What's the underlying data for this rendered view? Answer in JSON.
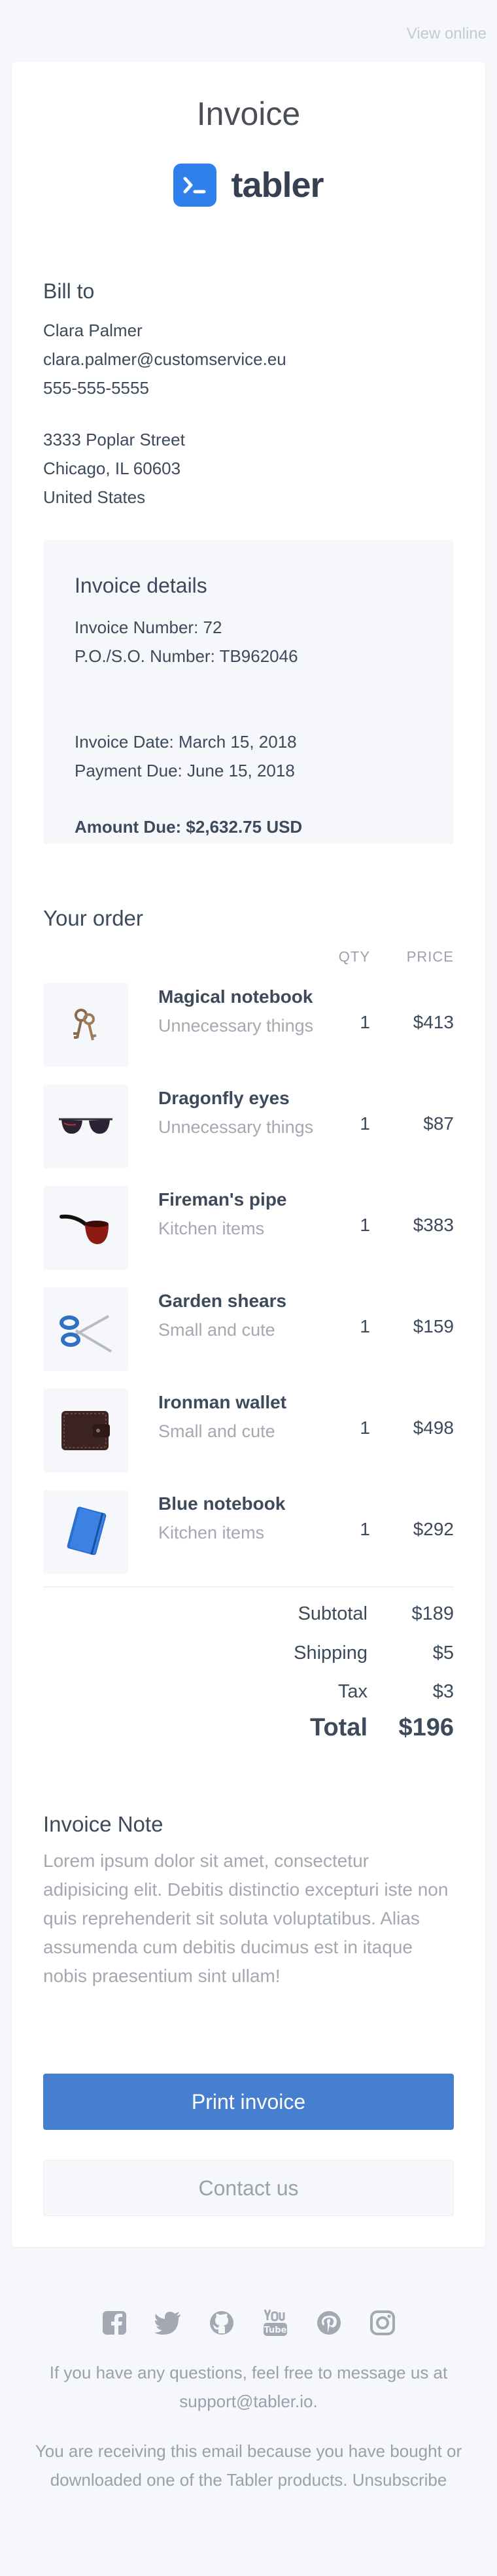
{
  "header": {
    "view_online": "View online"
  },
  "invoice": {
    "title": "Invoice",
    "brand": "tabler"
  },
  "bill_to": {
    "heading": "Bill to",
    "name": "Clara Palmer",
    "email": "clara.palmer@customservice.eu",
    "phone": "555-555-5555",
    "street": "3333 Poplar Street",
    "city": "Chicago, IL 60603",
    "country": "United States"
  },
  "details": {
    "heading": "Invoice details",
    "number": "Invoice Number: 72",
    "po": "P.O./S.O. Number: TB962046",
    "date": "Invoice Date: March 15, 2018",
    "due": "Payment Due: June 15, 2018",
    "amount": "Amount Due: $2,632.75 USD"
  },
  "order": {
    "heading": "Your order",
    "col_qty": "QTY",
    "col_price": "PRICE",
    "items": [
      {
        "name": "Magical notebook",
        "category": "Unnecessary things",
        "qty": "1",
        "price": "$413",
        "icon": "keys-icon"
      },
      {
        "name": "Dragonfly eyes",
        "category": "Unnecessary things",
        "qty": "1",
        "price": "$87",
        "icon": "sunglasses-icon"
      },
      {
        "name": "Fireman's pipe",
        "category": "Kitchen items",
        "qty": "1",
        "price": "$383",
        "icon": "pipe-icon"
      },
      {
        "name": "Garden shears",
        "category": "Small and cute",
        "qty": "1",
        "price": "$159",
        "icon": "scissors-icon"
      },
      {
        "name": "Ironman wallet",
        "category": "Small and cute",
        "qty": "1",
        "price": "$498",
        "icon": "wallet-icon"
      },
      {
        "name": "Blue notebook",
        "category": "Kitchen items",
        "qty": "1",
        "price": "$292",
        "icon": "notebook-icon"
      }
    ]
  },
  "totals": {
    "subtotal_label": "Subtotal",
    "subtotal": "$189",
    "shipping_label": "Shipping",
    "shipping": "$5",
    "tax_label": "Tax",
    "tax": "$3",
    "total_label": "Total",
    "total": "$196"
  },
  "note": {
    "heading": "Invoice Note",
    "text": "Lorem ipsum dolor sit amet, consectetur adipisicing elit. Debitis distinctio excepturi iste non quis reprehenderit sit soluta voluptatibus. Alias assumenda cum debitis ducimus est in itaque nobis praesentium sint ullam!"
  },
  "buttons": {
    "print": "Print invoice",
    "contact": "Contact us"
  },
  "footer": {
    "questions": "If you have any questions, feel free to message us at",
    "support_email": "support@tabler.io.",
    "receiving": "You are receiving this email because you have bought or downloaded one of the Tabler products.",
    "unsubscribe": "Unsubscribe",
    "socials": [
      "facebook-icon",
      "twitter-icon",
      "github-icon",
      "youtube-icon",
      "pinterest-icon",
      "instagram-icon"
    ]
  },
  "colors": {
    "accent": "#467fcf",
    "brand_blue": "#2f80ed",
    "background": "#f5f7fb",
    "muted": "#9aa0ac"
  }
}
